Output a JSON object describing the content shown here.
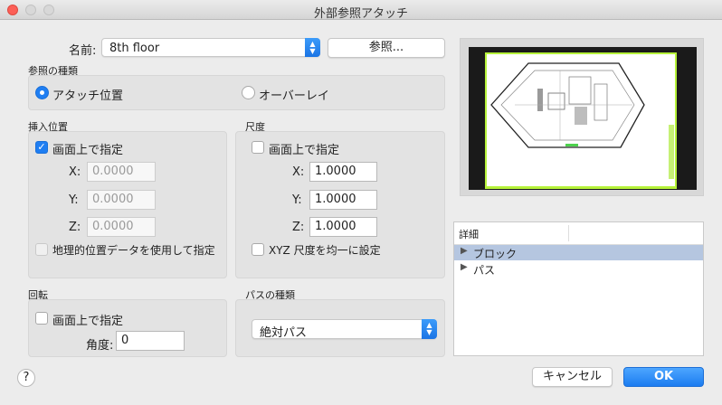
{
  "window": {
    "title": "外部参照アタッチ"
  },
  "name": {
    "label": "名前:",
    "value": "8th floor",
    "browse_label": "参照..."
  },
  "reference_type": {
    "title": "参照の種類",
    "options": [
      {
        "label": "アタッチ位置",
        "selected": true
      },
      {
        "label": "オーバーレイ",
        "selected": false
      }
    ]
  },
  "insertion": {
    "title": "挿入位置",
    "specify_on_screen": {
      "label": "画面上で指定",
      "checked": true
    },
    "x": {
      "label": "X:",
      "value": "0.0000"
    },
    "y": {
      "label": "Y:",
      "value": "0.0000"
    },
    "z": {
      "label": "Z:",
      "value": "0.0000"
    },
    "geo": {
      "label": "地理的位置データを使用して指定",
      "checked": false
    }
  },
  "scale": {
    "title": "尺度",
    "specify_on_screen": {
      "label": "画面上で指定",
      "checked": false
    },
    "x": {
      "label": "X:",
      "value": "1.0000"
    },
    "y": {
      "label": "Y:",
      "value": "1.0000"
    },
    "z": {
      "label": "Z:",
      "value": "1.0000"
    },
    "uniform": {
      "label": "XYZ 尺度を均一に設定",
      "checked": false
    }
  },
  "rotation": {
    "title": "回転",
    "specify_on_screen": {
      "label": "画面上で指定",
      "checked": false
    },
    "angle": {
      "label": "角度:",
      "value": "0"
    }
  },
  "path_type": {
    "title": "パスの種類",
    "value": "絶対パス"
  },
  "details": {
    "header": "詳細",
    "items": [
      {
        "label": "ブロック",
        "selected": true
      },
      {
        "label": "パス",
        "selected": false
      }
    ]
  },
  "footer": {
    "help": "?",
    "cancel": "キャンセル",
    "ok": "OK"
  },
  "colors": {
    "accent": "#1f7ef2",
    "selection": "#b5c6e0",
    "preview_border": "#b6f23a"
  }
}
